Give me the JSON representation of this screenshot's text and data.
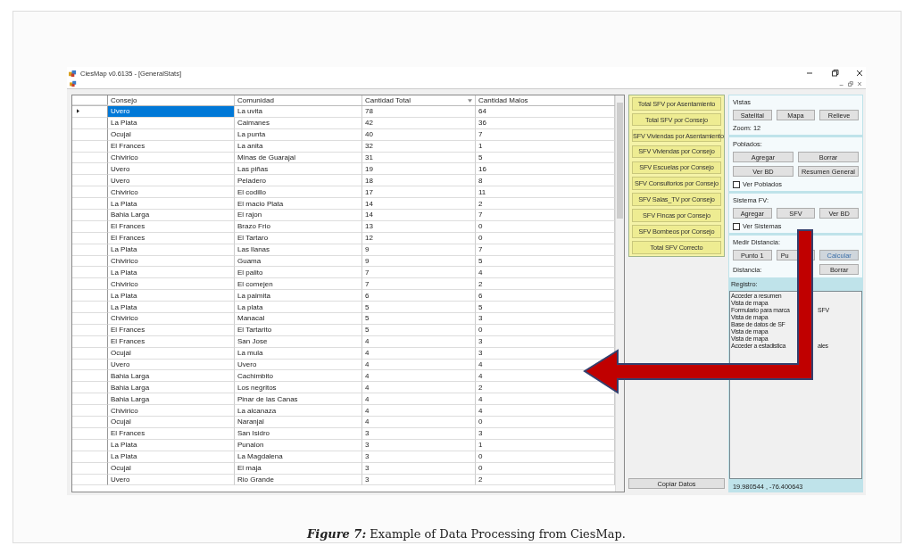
{
  "window": {
    "title": "CiesMap v0.6135 - [GeneralStats]"
  },
  "table": {
    "columns": [
      {
        "label": "Consejo",
        "sorted": false
      },
      {
        "label": "Comunidad",
        "sorted": false
      },
      {
        "label": "Cantidad Total",
        "sorted": true
      },
      {
        "label": "Cantidad Malos",
        "sorted": false
      }
    ],
    "rows": [
      {
        "selected": true,
        "cells": [
          "Uvero",
          "La uvita",
          "78",
          "64"
        ]
      },
      {
        "selected": false,
        "cells": [
          "La Plata",
          "Caimanes",
          "42",
          "36"
        ]
      },
      {
        "selected": false,
        "cells": [
          "Ocujal",
          "La punta",
          "40",
          "7"
        ]
      },
      {
        "selected": false,
        "cells": [
          "El Frances",
          "La anita",
          "32",
          "1"
        ]
      },
      {
        "selected": false,
        "cells": [
          "Chivirico",
          "Minas de Guarajal",
          "31",
          "5"
        ]
      },
      {
        "selected": false,
        "cells": [
          "Uvero",
          "Las piñas",
          "19",
          "16"
        ]
      },
      {
        "selected": false,
        "cells": [
          "Uvero",
          "Peladero",
          "18",
          "8"
        ]
      },
      {
        "selected": false,
        "cells": [
          "Chivirico",
          "El codillo",
          "17",
          "11"
        ]
      },
      {
        "selected": false,
        "cells": [
          "La Plata",
          "El macio Plata",
          "14",
          "2"
        ]
      },
      {
        "selected": false,
        "cells": [
          "Bahia Larga",
          "El rajon",
          "14",
          "7"
        ]
      },
      {
        "selected": false,
        "cells": [
          "El Frances",
          "Brazo Frio",
          "13",
          "0"
        ]
      },
      {
        "selected": false,
        "cells": [
          "El Frances",
          "El Tartaro",
          "12",
          "0"
        ]
      },
      {
        "selected": false,
        "cells": [
          "La Plata",
          "Las llanas",
          "9",
          "7"
        ]
      },
      {
        "selected": false,
        "cells": [
          "Chivirico",
          "Guama",
          "9",
          "5"
        ]
      },
      {
        "selected": false,
        "cells": [
          "La Plata",
          "El palito",
          "7",
          "4"
        ]
      },
      {
        "selected": false,
        "cells": [
          "Chivirico",
          "El comejen",
          "7",
          "2"
        ]
      },
      {
        "selected": false,
        "cells": [
          "La Plata",
          "La palmita",
          "6",
          "6"
        ]
      },
      {
        "selected": false,
        "cells": [
          "La Plata",
          "La plata",
          "5",
          "5"
        ]
      },
      {
        "selected": false,
        "cells": [
          "Chivirico",
          "Manacal",
          "5",
          "3"
        ]
      },
      {
        "selected": false,
        "cells": [
          "El Frances",
          "El Tartarito",
          "5",
          "0"
        ]
      },
      {
        "selected": false,
        "cells": [
          "El Frances",
          "San Jose",
          "4",
          "3"
        ]
      },
      {
        "selected": false,
        "cells": [
          "Ocujal",
          "La mula",
          "4",
          "3"
        ]
      },
      {
        "selected": false,
        "cells": [
          "Uvero",
          "Uvero",
          "4",
          "4"
        ]
      },
      {
        "selected": false,
        "cells": [
          "Bahia Larga",
          "Cachimbito",
          "4",
          "4"
        ]
      },
      {
        "selected": false,
        "cells": [
          "Bahia Larga",
          "Los negritos",
          "4",
          "2"
        ]
      },
      {
        "selected": false,
        "cells": [
          "Bahia Larga",
          "Pinar de las Canas",
          "4",
          "4"
        ]
      },
      {
        "selected": false,
        "cells": [
          "Chivirico",
          "La alcanaza",
          "4",
          "4"
        ]
      },
      {
        "selected": false,
        "cells": [
          "Ocujal",
          "Naranjal",
          "4",
          "0"
        ]
      },
      {
        "selected": false,
        "cells": [
          "El Frances",
          "San Isidro",
          "3",
          "3"
        ]
      },
      {
        "selected": false,
        "cells": [
          "La Plata",
          "Punalon",
          "3",
          "1"
        ]
      },
      {
        "selected": false,
        "cells": [
          "La Plata",
          "La Magdalena",
          "3",
          "0"
        ]
      },
      {
        "selected": false,
        "cells": [
          "Ocujal",
          "El maja",
          "3",
          "0"
        ]
      },
      {
        "selected": false,
        "cells": [
          "Uvero",
          "Rio Grande",
          "3",
          "2"
        ]
      }
    ]
  },
  "stats_buttons": [
    "Total SFV por Asentamiento",
    "Total SFV por Consejo",
    "SFV Viviendas por Asentamiento",
    "SFV Viviendas por Consejo",
    "SFV Escuelas por Consejo",
    "SFV Consultorios por Consejo",
    "SFV Salas_TV por Consejo",
    "SFV Fincas por Consejo",
    "SFV Bombeos por Consejo",
    "Total SFV Correcto"
  ],
  "copy_button": "Copiar Datos",
  "vistas": {
    "title": "Vistas",
    "buttons": [
      "Satelital",
      "Mapa",
      "Relieve"
    ],
    "zoom": "Zoom: 12"
  },
  "poblados": {
    "title": "Poblados:",
    "buttons": [
      "Agregar",
      "Borrar",
      "Ver BD",
      "Resumen General"
    ],
    "checkbox": {
      "label": "Ver Poblados",
      "checked": false
    }
  },
  "sistema_fv": {
    "title": "Sistema FV:",
    "buttons": [
      "Agregar",
      "SFV",
      "Ver BD"
    ],
    "checkbox": {
      "label": "Ver Sistemas",
      "checked": false
    }
  },
  "medir": {
    "title": "Medir Distancia:",
    "buttons": [
      {
        "label": "Punto 1",
        "disabled": false
      },
      {
        "label": "Pu",
        "disabled": false
      },
      {
        "label": "Calcular",
        "disabled": true
      }
    ],
    "distance_label": "Distancia:",
    "clear_button": "Borrar"
  },
  "registro": {
    "title": "Registro:",
    "lines": [
      {
        "parts": [
          "Acceder a resumen"
        ]
      },
      {
        "parts": [
          "Vista de mapa"
        ]
      },
      {
        "parts": [
          "Formulario para marca",
          "SFV"
        ]
      },
      {
        "parts": [
          "Vista de mapa"
        ]
      },
      {
        "parts": [
          "Base de datos de SF"
        ]
      },
      {
        "parts": [
          "Vista de mapa"
        ]
      },
      {
        "parts": [
          "Vista de mapa"
        ]
      },
      {
        "parts": [
          "Acceder a estadistica",
          "ales"
        ]
      }
    ]
  },
  "status": "19.980544 , -76.400643",
  "caption": "**Figure 7:** Example of Data Processing from CiesMap."
}
